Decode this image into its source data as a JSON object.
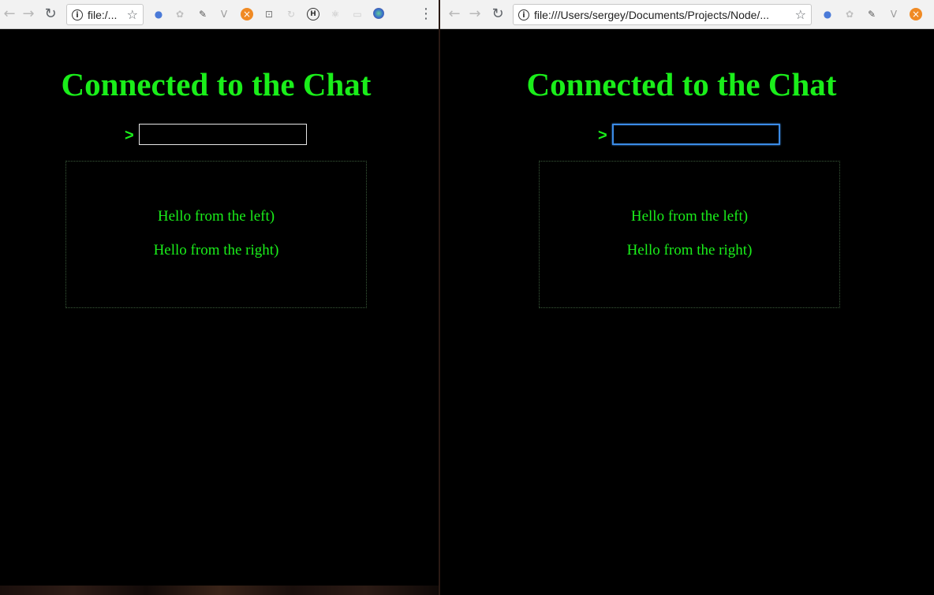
{
  "left_window": {
    "url": "file:/...",
    "page_title": "Connected to the Chat",
    "prompt": ">",
    "input_value": "",
    "messages": [
      "Hello from the left)",
      "Hello from the right)"
    ]
  },
  "right_window": {
    "url": "file:///Users/sergey/Documents/Projects/Node/...",
    "page_title": "Connected to the Chat",
    "prompt": ">",
    "input_value": "",
    "messages": [
      "Hello from the left)",
      "Hello from the right)"
    ]
  },
  "icons": {
    "back": "←",
    "forward": "→",
    "reload": "↻",
    "info": "i",
    "star": "☆",
    "menu": "⋮"
  },
  "colors": {
    "accent_green": "#1aee1a",
    "focus_blue": "#3b8be6",
    "background": "#000000"
  }
}
